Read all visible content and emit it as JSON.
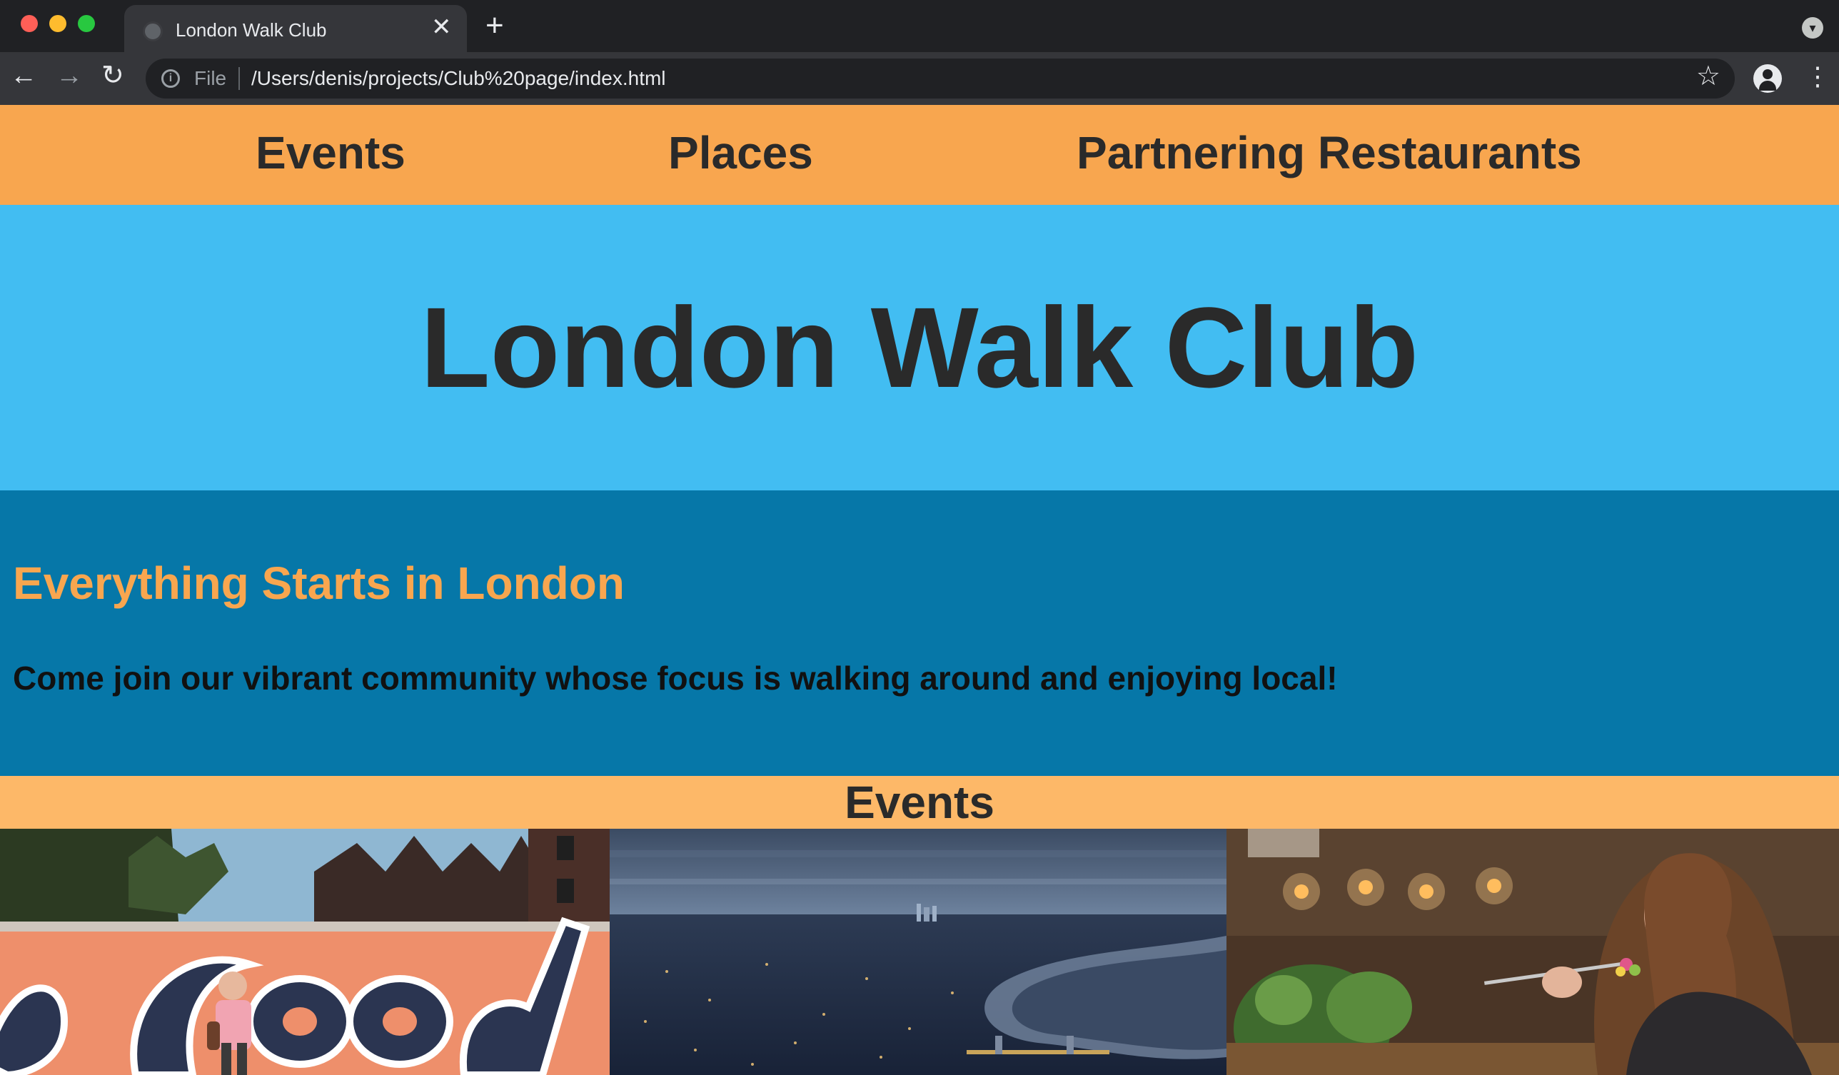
{
  "browser": {
    "tab_title": "London Walk Club",
    "tab_close": "✕",
    "new_tab": "+",
    "tab_menu": "▾",
    "back": "←",
    "forward": "→",
    "reload": "↻",
    "info": "i",
    "file_label": "File",
    "url": "/Users/denis/projects/Club%20page/index.html",
    "bookmark": "☆",
    "menu": "⋮"
  },
  "nav": {
    "events": "Events",
    "places": "Places",
    "restaurants": "Partnering Restaurants"
  },
  "hero": {
    "title": "London Walk Club"
  },
  "intro": {
    "heading": "Everything Starts in London",
    "text": "Come join our vibrant community whose focus is walking around and enjoying local!"
  },
  "events": {
    "heading": "Events"
  },
  "colors": {
    "nav_bg": "#f8a64f",
    "hero_bg": "#42bdf2",
    "intro_bg": "#0677a8",
    "events_heading_bg": "#fdb868"
  }
}
